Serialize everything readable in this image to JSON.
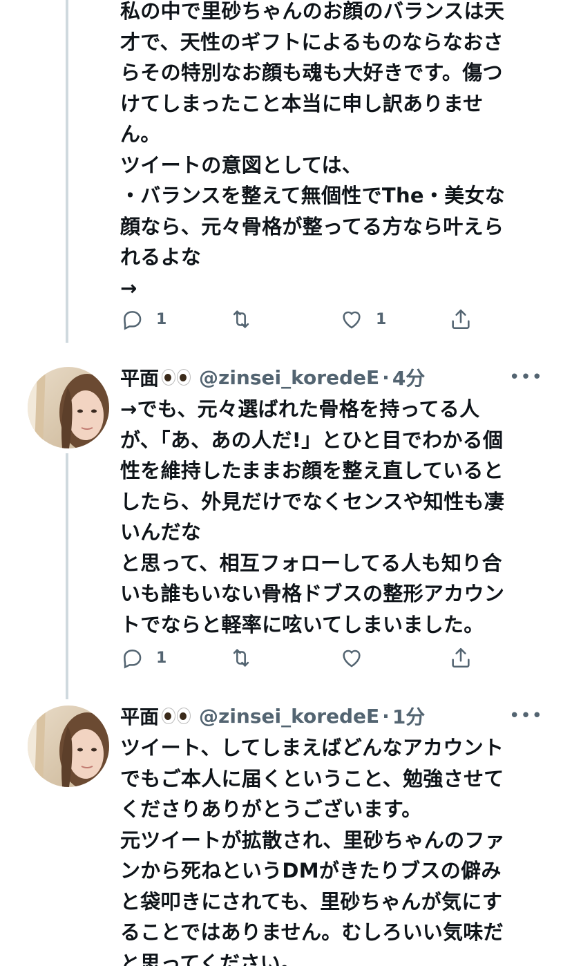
{
  "tweets": [
    {
      "text": "私の中で里砂ちゃんのお顔のバランスは天\n才で、天性のギフトによるものならなおさ\nらその特別なお顔も魂も大好きです。傷つ\nけてしまったこと本当に申し訳ありませ\nん。\nツイートの意図としては、\n・バランスを整えて無個性でThe・美女な\n顔なら、元々骨格が整ってる方なら叶えら\nれるよな\n→",
      "reply_count": "1",
      "retweet_count": "",
      "like_count": "1"
    },
    {
      "display_name": "平面",
      "handle": "@zinsei_koredeE",
      "separator": "·",
      "time": "4分",
      "text": "→でも、元々選ばれた骨格を持ってる人\nが、「あ、あの人だ!」とひと目でわかる個\n性を維持したままお顔を整え直していると\nしたら、外見だけでなくセンスや知性も凄\nいんだな\nと思って、相互フォローしてる人も知り合\nいも誰もいない骨格ドブスの整形アカウン\nトでならと軽率に呟いてしまいました。",
      "reply_count": "1",
      "retweet_count": "",
      "like_count": ""
    },
    {
      "display_name": "平面",
      "handle": "@zinsei_koredeE",
      "separator": "·",
      "time": "1分",
      "text": "ツイート、してしまえばどんなアカウント\nでもご本人に届くということ、勉強させて\nくださりありがとうございます。\n元ツイートが拡散され、里砂ちゃんのファ\nンから死ねというDMがきたりブスの僻み\nと袋叩きにされても、里砂ちゃんが気にす\nることではありません。むしろいい気味だ\nと思ってください。"
    }
  ],
  "more_label": "•••",
  "icons": {
    "reply": "reply-icon",
    "retweet": "retweet-icon",
    "like": "heart-icon",
    "share": "share-icon",
    "emoji": "eyes-emoji"
  },
  "colors": {
    "text": "#0f1419",
    "secondary": "#536471",
    "thread_line": "#cfd9de"
  }
}
